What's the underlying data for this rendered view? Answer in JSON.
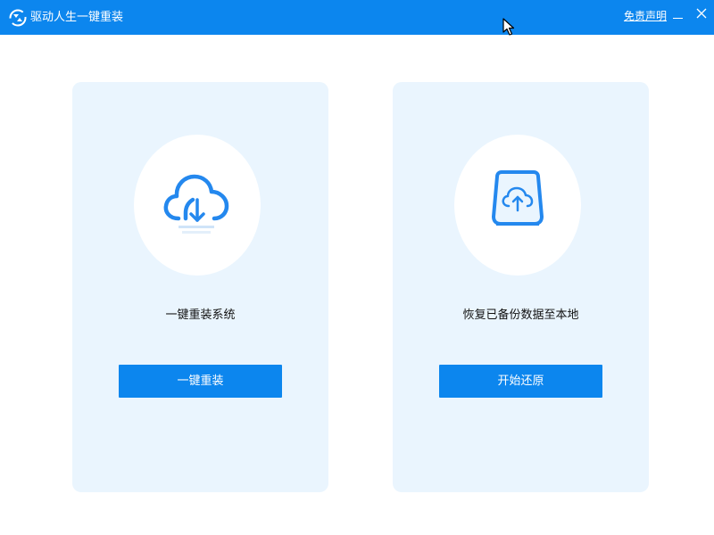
{
  "app": {
    "title": "驱动人生一键重装",
    "disclaimer": "免责声明",
    "accent_color": "#0c86ee"
  },
  "cards": [
    {
      "icon": "cloud-download-icon",
      "label": "一键重装系统",
      "button": "一键重装"
    },
    {
      "icon": "backup-restore-icon",
      "label": "恢复已备份数据至本地",
      "button": "开始还原"
    }
  ]
}
